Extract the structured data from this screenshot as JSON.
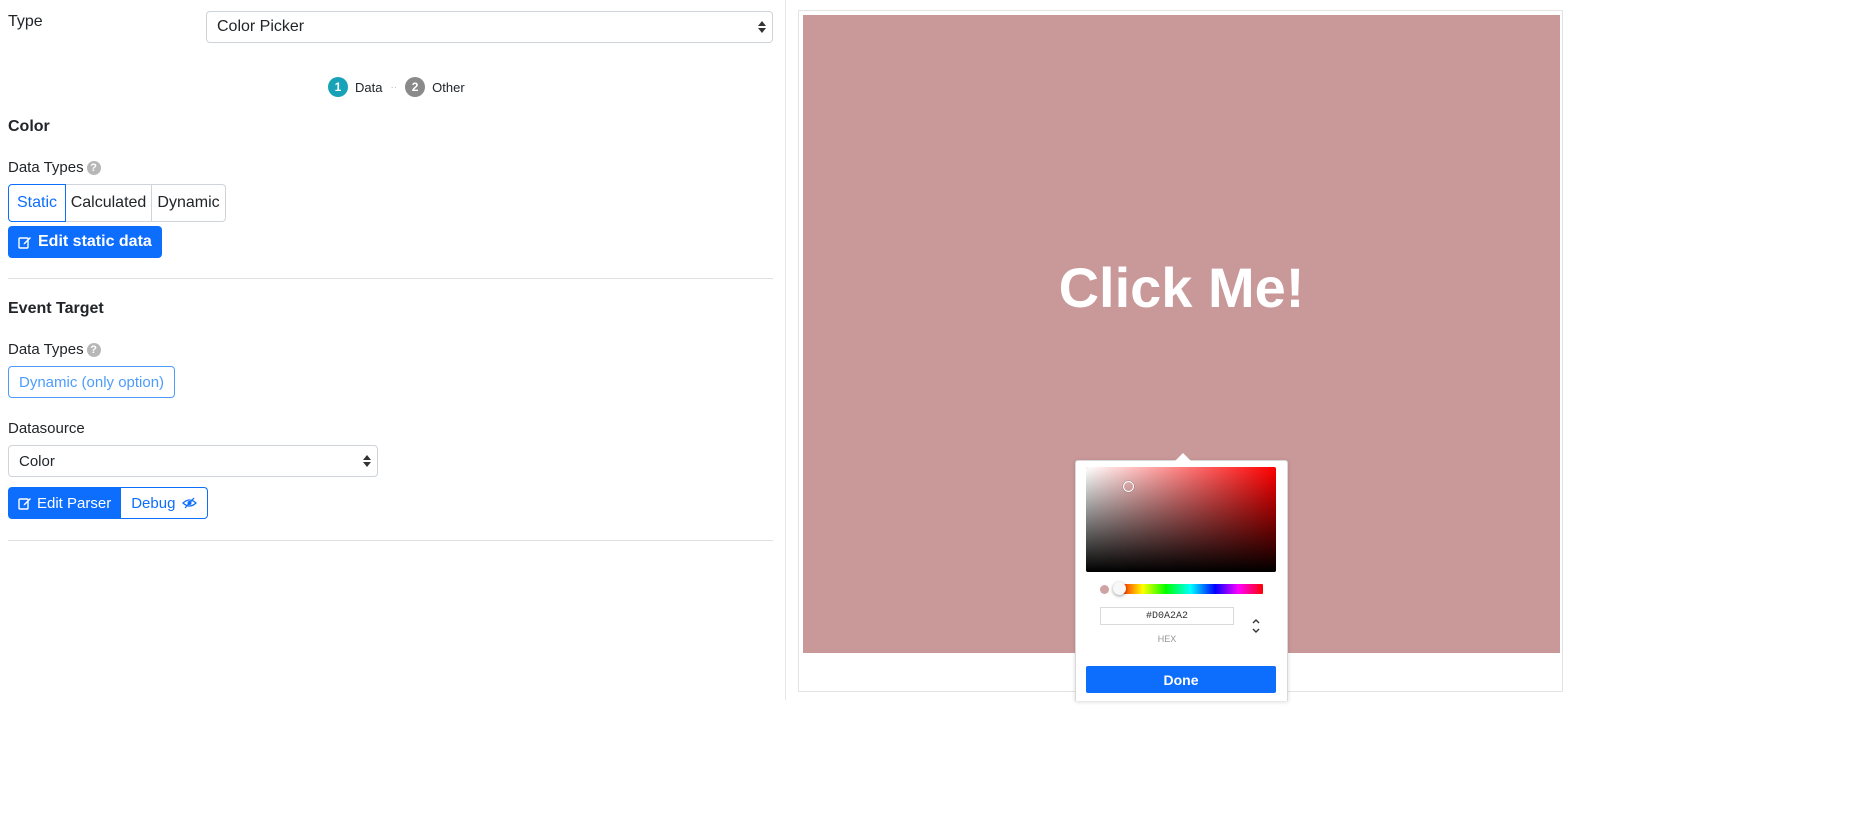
{
  "type_field": {
    "label": "Type",
    "value": "Color Picker"
  },
  "steps": [
    {
      "num": "1",
      "label": "Data"
    },
    {
      "num": "2",
      "label": "Other"
    }
  ],
  "color_section": {
    "title": "Color",
    "data_types_label": "Data Types",
    "options": [
      "Static",
      "Calculated",
      "Dynamic"
    ],
    "selected": "Static",
    "edit_button": "Edit static data"
  },
  "event_target_section": {
    "title": "Event Target",
    "data_types_label": "Data Types",
    "option": "Dynamic (only option)",
    "datasource_label": "Datasource",
    "datasource_value": "Color",
    "edit_parser_button": "Edit Parser",
    "debug_button": "Debug"
  },
  "preview": {
    "button_text": "Click Me!",
    "background_color": "#C99899"
  },
  "color_picker": {
    "hex_value": "#D0A2A2",
    "mode_label": "HEX",
    "done_label": "Done",
    "hue_color": "#ff0000"
  },
  "colors": {
    "primary": "#0d6efd",
    "step_active": "#17a2b8",
    "step_inactive": "#8a8a8a"
  },
  "icons": {
    "help": "question-circle-icon",
    "edit": "edit-icon",
    "eye": "eye-slash-icon",
    "select_caret": "sort-arrows-icon",
    "mode_toggle": "up-down-chevron-icon"
  }
}
